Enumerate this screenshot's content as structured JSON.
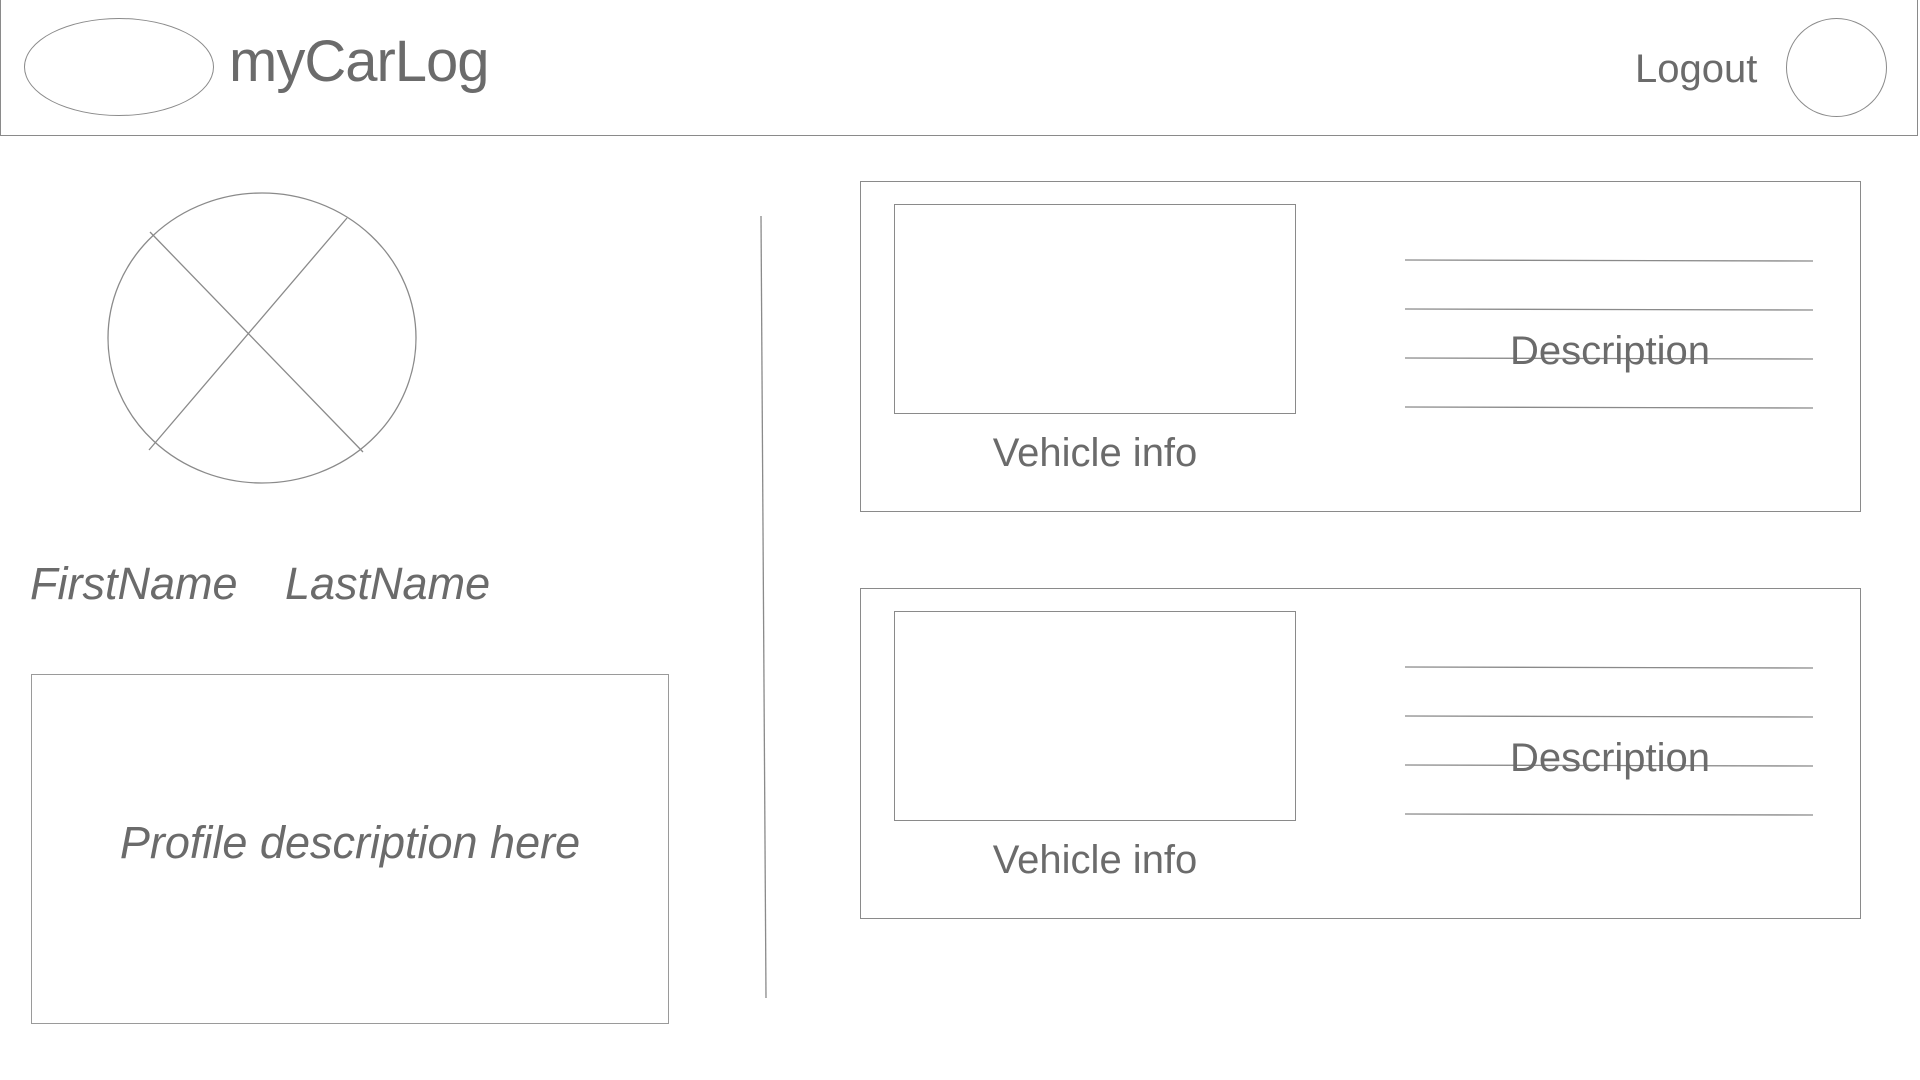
{
  "header": {
    "title": "myCarLog",
    "logout_label": "Logout"
  },
  "profile": {
    "first_name": "FirstName",
    "last_name": "LastName",
    "description": "Profile description here"
  },
  "vehicles": [
    {
      "info_label": "Vehicle info",
      "description_label": "Description"
    },
    {
      "info_label": "Vehicle info",
      "description_label": "Description"
    }
  ],
  "icons": {
    "logo": "logo-placeholder-icon",
    "user": "user-avatar-icon",
    "profile_picture": "image-placeholder-icon"
  },
  "colors": {
    "line": "#8a8a8a",
    "text": "#6b6b6b",
    "background": "#ffffff"
  }
}
